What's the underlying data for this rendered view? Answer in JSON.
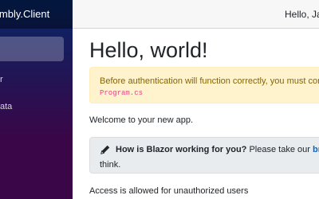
{
  "sidebar": {
    "brand": "Assembly.Client",
    "items": [
      {
        "label": ""
      },
      {
        "label": "r"
      },
      {
        "label": "ata"
      }
    ]
  },
  "topbar": {
    "greeting": "Hello, Jar"
  },
  "main": {
    "heading": "Hello, world!",
    "alert": {
      "text": "Before authentication will function correctly, you must configu",
      "code": "Program.cs"
    },
    "welcome": "Welcome to your new app.",
    "survey": {
      "question": "How is Blazor working for you?",
      "prompt": " Please take our ",
      "link": "brief",
      "continuation": "think."
    },
    "access_note": "Access is allowed for unauthorized users"
  },
  "colors": {
    "alert_bg": "#fff3cd",
    "link": "#0366d6",
    "code": "#e83e8c"
  }
}
